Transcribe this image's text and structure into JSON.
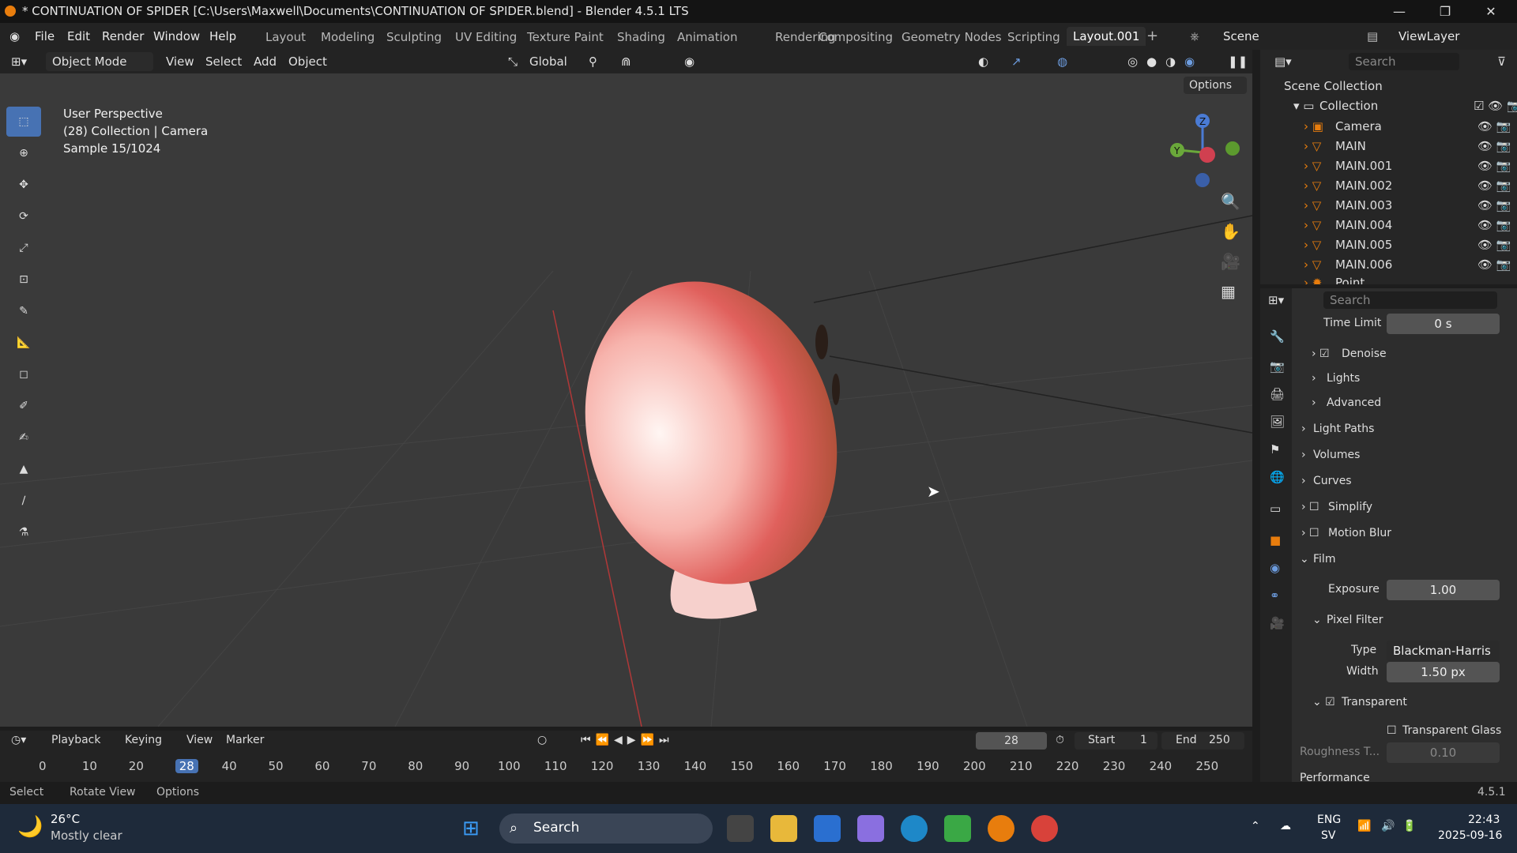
{
  "window": {
    "title": "* CONTINUATION OF SPIDER [C:\\Users\\Maxwell\\Documents\\CONTINUATION OF SPIDER.blend] - Blender 4.5.1 LTS"
  },
  "menu": [
    "File",
    "Edit",
    "Render",
    "Window",
    "Help"
  ],
  "workspaces": [
    "Layout",
    "Modeling",
    "Sculpting",
    "UV Editing",
    "Texture Paint",
    "Shading",
    "Animation",
    "Rendering",
    "Compositing",
    "Geometry Nodes",
    "Scripting",
    "Layout.001"
  ],
  "scene": "Scene",
  "view_layer": "ViewLayer",
  "viewport_header": {
    "mode": "Object Mode",
    "view": "View",
    "select": "Select",
    "add": "Add",
    "object": "Object",
    "orientation": "Global",
    "options": "Options"
  },
  "overlay": {
    "line1": "User Perspective",
    "line2": "(28) Collection | Camera",
    "line3": "Sample 15/1024"
  },
  "outliner": {
    "search_placeholder": "Search",
    "scene_collection": "Scene Collection",
    "collection": "Collection",
    "items": [
      "Camera",
      "MAIN",
      "MAIN.001",
      "MAIN.002",
      "MAIN.003",
      "MAIN.004",
      "MAIN.005",
      "MAIN.006",
      "Point"
    ]
  },
  "properties": {
    "search_placeholder": "Search",
    "time_limit_label": "Time Limit",
    "time_limit": "0 s",
    "denoise": "Denoise",
    "lights": "Lights",
    "advanced": "Advanced",
    "light_paths": "Light Paths",
    "volumes": "Volumes",
    "curves": "Curves",
    "simplify": "Simplify",
    "motion_blur": "Motion Blur",
    "film": "Film",
    "exposure_label": "Exposure",
    "exposure": "1.00",
    "pixel_filter": "Pixel Filter",
    "type_label": "Type",
    "type": "Blackman-Harris",
    "width_label": "Width",
    "width": "1.50 px",
    "transparent": "Transparent",
    "transparent_glass": "Transparent Glass",
    "roughness_label": "Roughness T...",
    "roughness": "0.10",
    "performance": "Performance"
  },
  "timeline": {
    "playback": "Playback",
    "keying": "Keying",
    "view": "View",
    "marker": "Marker",
    "current_frame": "28",
    "start_label": "Start",
    "start": "1",
    "end_label": "End",
    "end": "250",
    "ticks": [
      "0",
      "10",
      "20",
      "28",
      "40",
      "50",
      "60",
      "70",
      "80",
      "90",
      "100",
      "110",
      "120",
      "130",
      "140",
      "150",
      "160",
      "170",
      "180",
      "190",
      "200",
      "210",
      "220",
      "230",
      "240",
      "250"
    ]
  },
  "statusbar": {
    "select": "Select",
    "rotate": "Rotate View",
    "options": "Options",
    "version": "4.5.1"
  },
  "taskbar": {
    "temp": "26°C",
    "weather": "Mostly clear",
    "search": "Search",
    "lang1": "ENG",
    "lang2": "SV",
    "time": "22:43",
    "date": "2025-09-16"
  },
  "colors": {
    "accent": "#4772b3",
    "orange": "#e87d0d",
    "viewport": "#3a3a3a"
  }
}
